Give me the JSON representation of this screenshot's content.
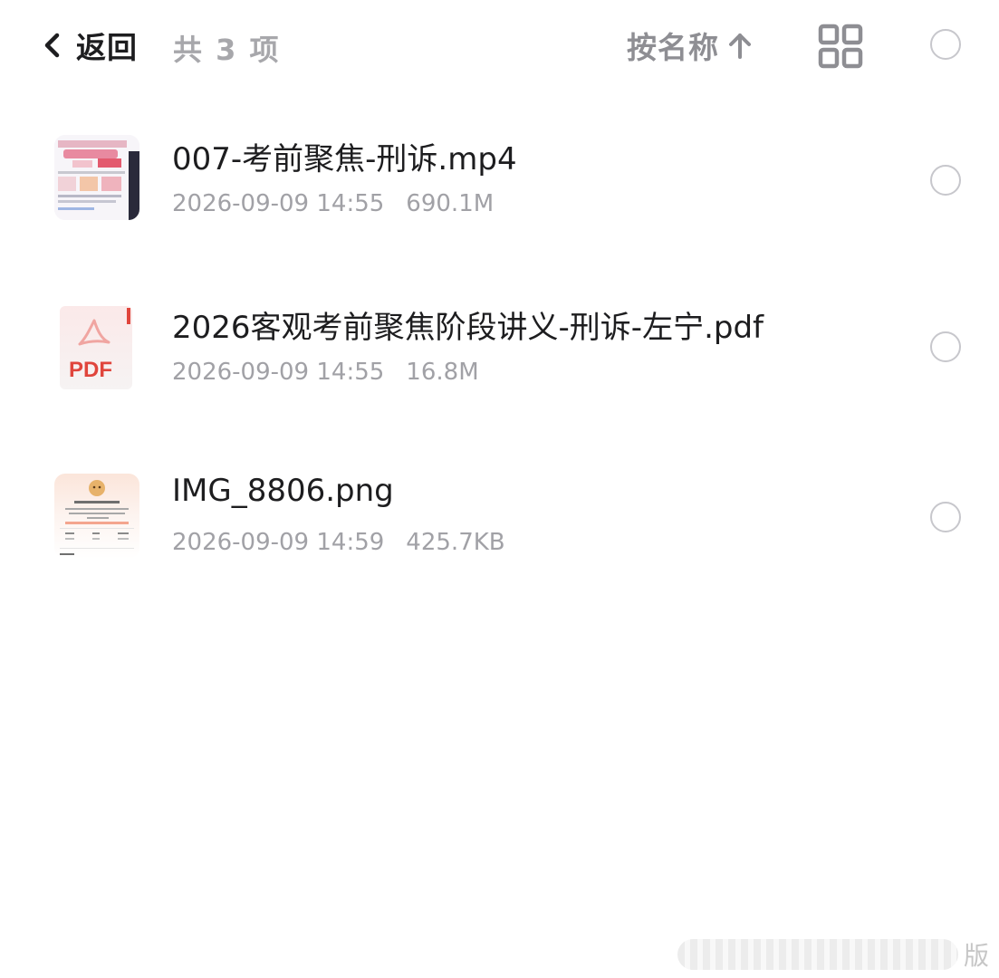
{
  "header": {
    "back_label": "返回",
    "item_count": "共 3 项",
    "sort_label": "按名称"
  },
  "files": [
    {
      "name": "007-考前聚焦-刑诉.mp4",
      "date": "2026-09-09 14:55",
      "size": "690.1M",
      "type": "video"
    },
    {
      "name": "2026客观考前聚焦阶段讲义-刑诉-左宁.pdf",
      "date": "2026-09-09 14:55",
      "size": "16.8M",
      "type": "pdf",
      "thumb_label": "PDF"
    },
    {
      "name": "IMG_8806.png",
      "date": "2026-09-09 14:59",
      "size": "425.7KB",
      "type": "image"
    }
  ],
  "watermark": {
    "text": "版"
  },
  "colors": {
    "text_primary": "#1d1d1f",
    "text_secondary": "#a1a1a6",
    "pdf_red": "#e0453c",
    "checkbox_border": "#c7c7cc"
  }
}
